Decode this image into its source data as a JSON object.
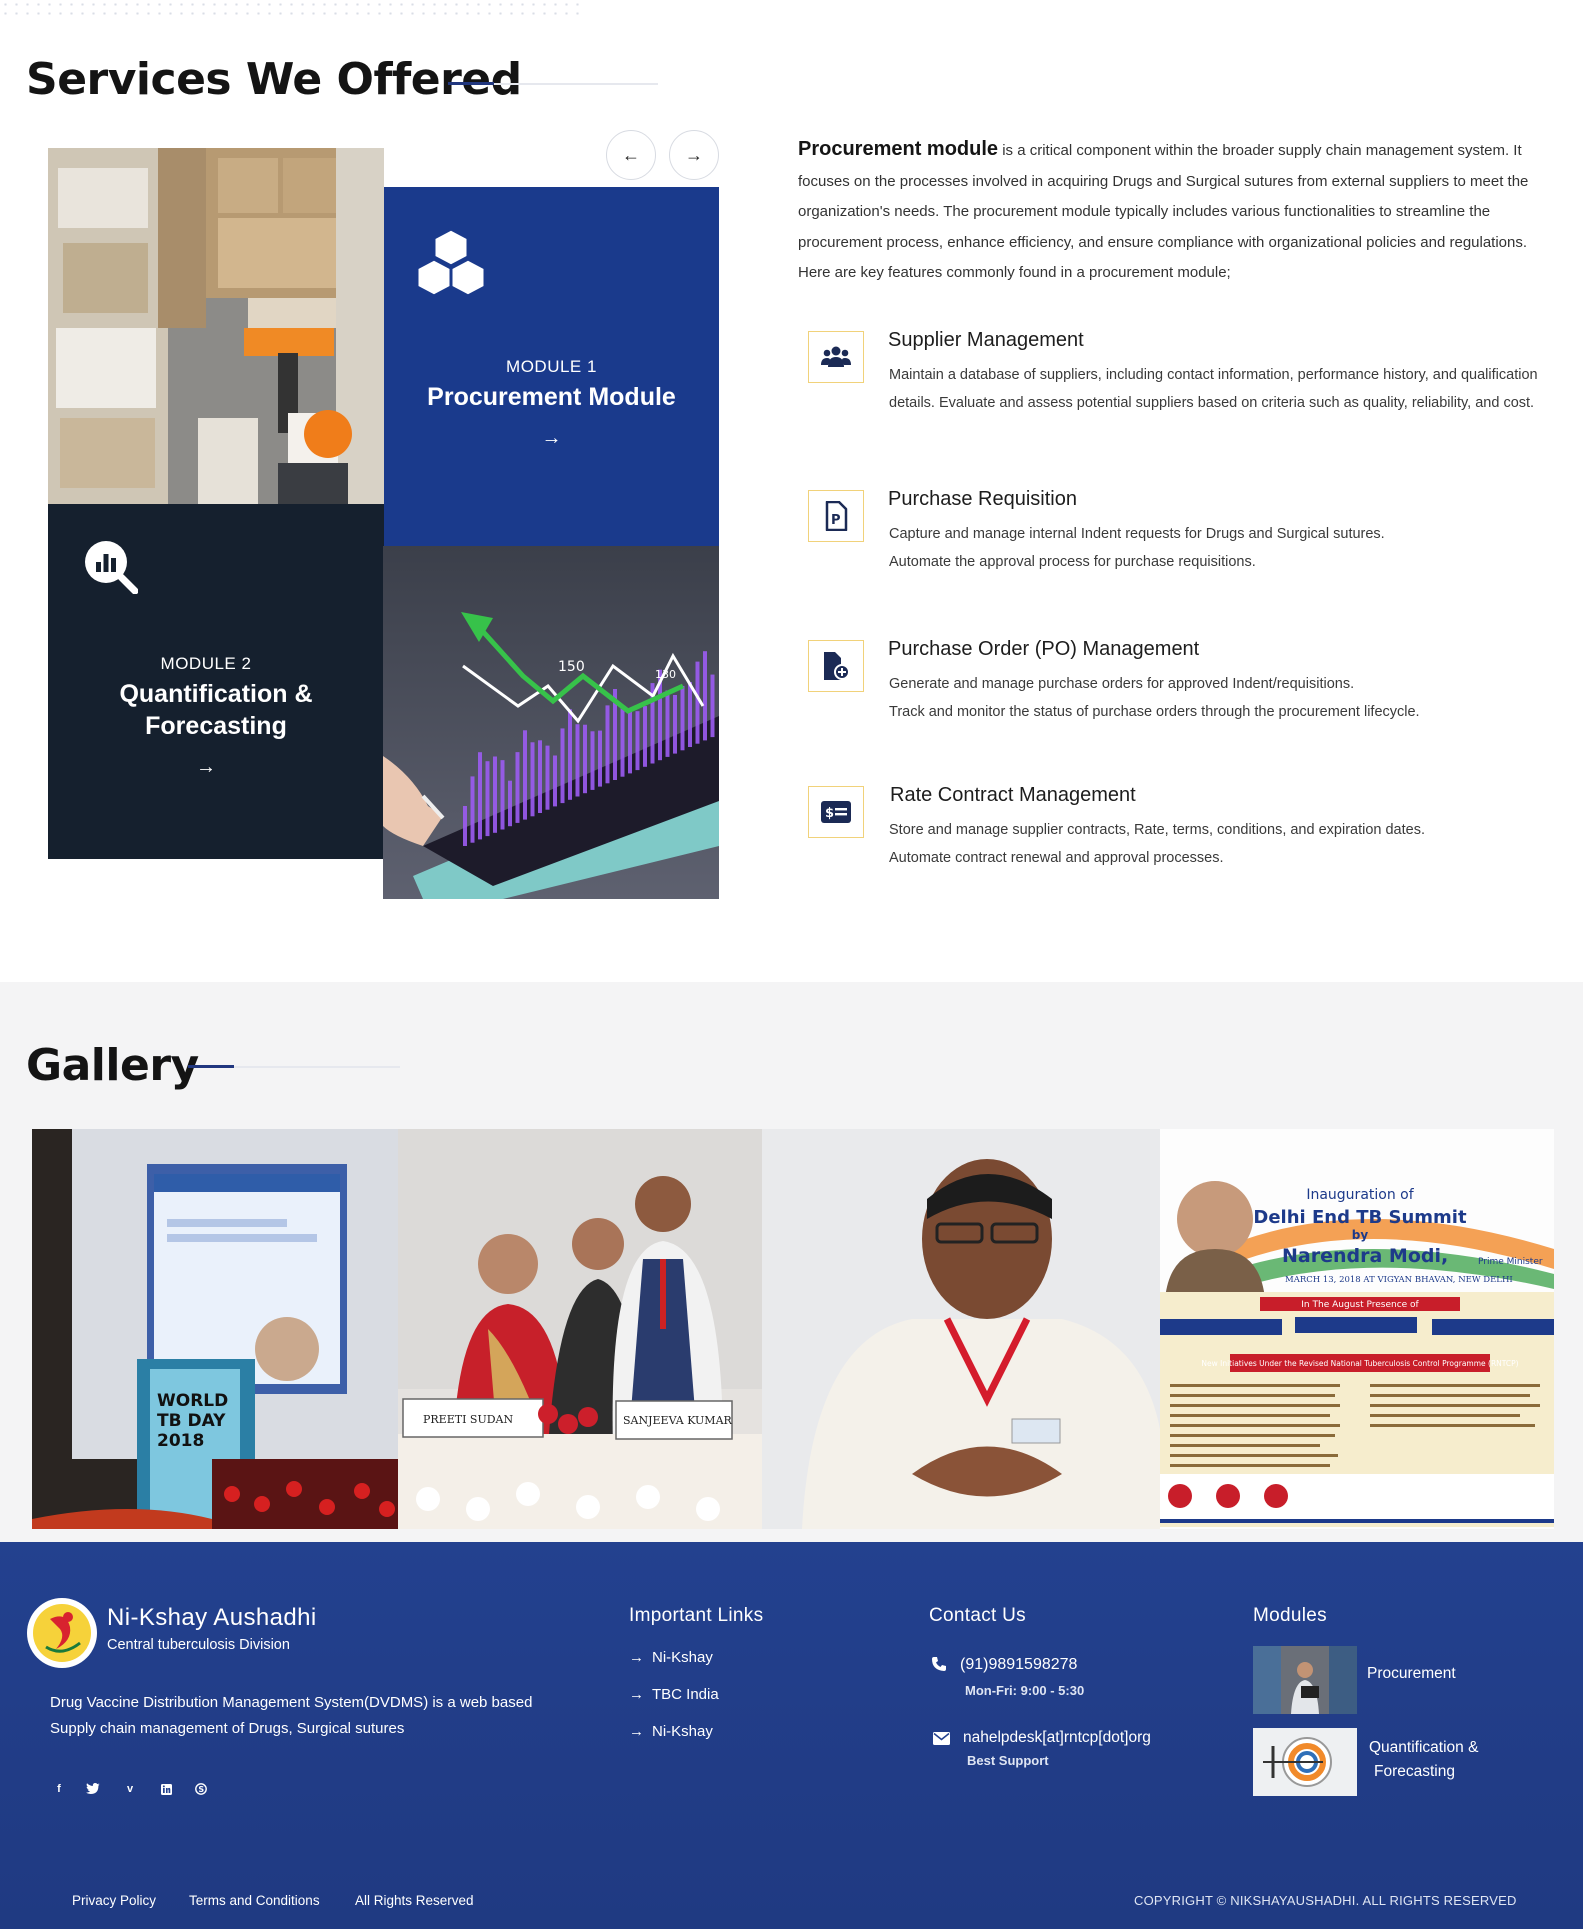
{
  "services": {
    "title": "Services We Offered",
    "modules": [
      {
        "num": "MODULE 1",
        "name": "Procurement Module",
        "icon": "cubes-icon",
        "color": "#1a3a8c"
      },
      {
        "num": "MODULE 2",
        "name_line1": "Quantification &",
        "name_line2": "Forecasting",
        "icon": "chart-search-icon",
        "color": "#15202e"
      }
    ],
    "chart_label_a": "150",
    "chart_label_b": "130",
    "intro_bold": "Procurement module",
    "intro_text": " is a critical component within the broader supply chain management system. It focuses on the processes involved in acquiring Drugs and Surgical sutures from external suppliers to meet the organization's needs. The procurement module typically includes various functionalities to streamline the procurement process, enhance efficiency, and ensure compliance with organizational policies and regulations. Here are key features commonly found in a procurement module;",
    "features": [
      {
        "title": "Supplier Management",
        "desc": "Maintain a database of suppliers, including contact information, performance history, and qualification details. Evaluate and assess potential suppliers based on criteria such as quality, reliability, and cost.",
        "icon": "users-icon"
      },
      {
        "title": "Purchase Requisition",
        "desc_1": "Capture and manage internal Indent requests for Drugs and Surgical sutures.",
        "desc_2": "Automate the approval process for purchase requisitions.",
        "icon": "document-p-icon"
      },
      {
        "title": "Purchase Order (PO) Management",
        "desc_1": "Generate and manage purchase orders for approved Indent/requisitions.",
        "desc_2": "Track and monitor the status of purchase orders through the procurement lifecycle.",
        "icon": "file-plus-icon"
      },
      {
        "title": "Rate Contract Management",
        "desc_1": "Store and manage supplier contracts, Rate, terms, conditions, and expiration dates.",
        "desc_2": "Automate contract renewal and approval processes.",
        "icon": "money-card-icon"
      }
    ]
  },
  "gallery": {
    "title": "Gallery",
    "img1": {
      "podium_line1": "WORLD",
      "podium_line2": "TB DAY",
      "podium_line3": "2018"
    },
    "img2": {
      "name_a": "PREETI SUDAN",
      "name_b": "SANJEEVA KUMAR"
    },
    "img4": {
      "line1": "Inauguration of",
      "line2": "Delhi End TB Summit",
      "line3": "by",
      "line4": "Narendra Modi,",
      "line4b": "Prime Minister",
      "line5": "MARCH 13, 2018 AT VIGYAN BHAVAN, NEW DELHI",
      "line6": "In The August Presence of",
      "line7": "New Initiatives Under the Revised National Tuberculosis Control Programme (RNTCP)"
    }
  },
  "footer": {
    "brand": "Ni-Kshay Aushadhi",
    "subbrand": "Central tuberculosis Division",
    "about": "Drug Vaccine Distribution Management System(DVDMS) is a web based Supply chain management of Drugs, Surgical sutures",
    "links_title": "Important Links",
    "links": [
      "Ni-Kshay",
      "TBC India",
      "Ni-Kshay"
    ],
    "contact_title": "Contact Us",
    "phone": "(91)9891598278",
    "hours": "Mon-Fri: 9:00 - 5:30",
    "email": "nahelpdesk[at]rntcp[dot]org",
    "support": "Best Support",
    "modules_title": "Modules",
    "module_links": [
      "Procurement",
      "Quantification &",
      "Forecasting"
    ],
    "socials": [
      "facebook-icon",
      "twitter-icon",
      "vimeo-icon",
      "linkedin-icon",
      "skype-icon"
    ],
    "bottom_links": [
      "Privacy Policy",
      "Terms and Conditions",
      "All Rights Reserved"
    ],
    "copyright": "COPYRIGHT © NIKSHAYAUSHADHI. ALL RIGHTS RESERVED"
  }
}
